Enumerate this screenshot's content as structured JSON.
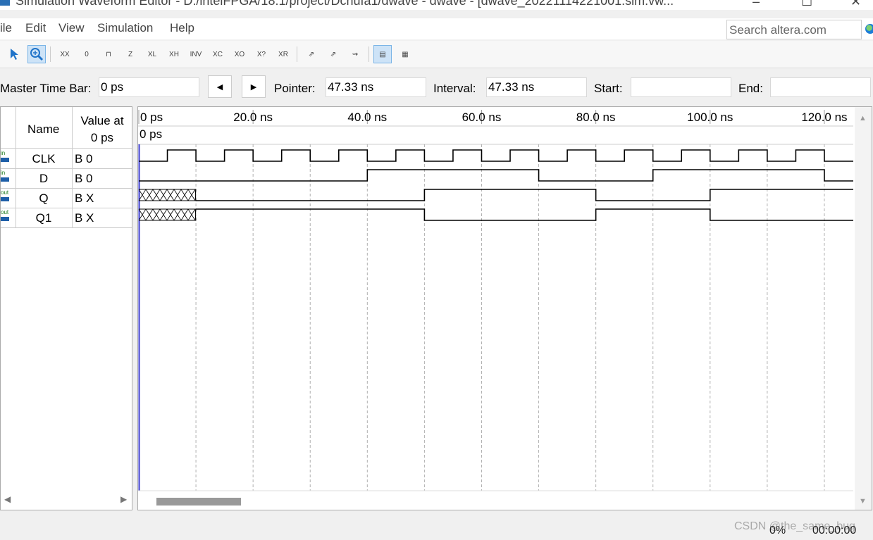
{
  "window": {
    "title": "Simulation Waveform Editor - D:/intelFPGA/18.1/project/Dchufa1/dwave - dwave - [dwave_20221114221001.sim.vw..."
  },
  "menu": [
    "ile",
    "Edit",
    "View",
    "Simulation",
    "Help"
  ],
  "search": {
    "placeholder": "Search altera.com"
  },
  "toolbar": {
    "items": [
      {
        "icon": "selection-tool-icon",
        "label": "select"
      },
      {
        "icon": "zoom-tool-icon",
        "label": "zoom"
      },
      {
        "icon": "force-unknown-icon",
        "label": "XX"
      },
      {
        "icon": "force-low-icon",
        "label": "0"
      },
      {
        "icon": "force-high-icon",
        "label": "1"
      },
      {
        "icon": "force-high-impedance-icon",
        "label": "Z"
      },
      {
        "icon": "force-weak-low-icon",
        "label": "L"
      },
      {
        "icon": "force-weak-high-icon",
        "label": "H"
      },
      {
        "icon": "invert-icon",
        "label": "INV"
      },
      {
        "icon": "count-value-icon",
        "label": "C"
      },
      {
        "icon": "overwrite-clock-icon",
        "label": "O"
      },
      {
        "icon": "arbitrary-value-icon",
        "label": "?"
      },
      {
        "icon": "random-value-icon",
        "label": "R"
      },
      {
        "icon": "run-functional-simulation-icon",
        "label": ""
      },
      {
        "icon": "run-timing-simulation-icon",
        "label": ""
      },
      {
        "icon": "generate-netlist-icon",
        "label": ""
      },
      {
        "icon": "snap-to-grid-icon",
        "label": ""
      },
      {
        "icon": "grid-settings-icon",
        "label": ""
      }
    ]
  },
  "timebar": {
    "master_label": "Master Time Bar:",
    "master_value": "0 ps",
    "pointer_label": "Pointer:",
    "pointer_value": "47.33 ns",
    "interval_label": "Interval:",
    "interval_value": "47.33 ns",
    "start_label": "Start:",
    "start_value": "",
    "end_label": "End:",
    "end_value": ""
  },
  "table": {
    "name_header": "Name",
    "value_header_line1": "Value at",
    "value_header_line2": "0 ps",
    "signals": [
      {
        "direction": "in",
        "name": "CLK",
        "value": "B 0"
      },
      {
        "direction": "in",
        "name": "D",
        "value": "B 0"
      },
      {
        "direction": "out",
        "name": "Q",
        "value": "B X"
      },
      {
        "direction": "out",
        "name": "Q1",
        "value": "B X"
      }
    ]
  },
  "waveform": {
    "time_unit": "ns",
    "ruler_labels": [
      "0 ps",
      "20.0 ns",
      "40.0 ns",
      "60.0 ns",
      "80.0 ns",
      "100.0 ns",
      "120.0 ns"
    ],
    "ruler_values_ns": [
      0,
      20,
      40,
      60,
      80,
      100,
      120
    ],
    "cursor_label": "0 ps",
    "view_end_ns": 125,
    "grid_step_ns": 10,
    "traces": {
      "CLK": {
        "init": 0,
        "transitions_ns": [
          5,
          10,
          15,
          20,
          25,
          30,
          35,
          40,
          45,
          50,
          55,
          60,
          65,
          70,
          75,
          80,
          85,
          90,
          95,
          100,
          105,
          110,
          115,
          120
        ]
      },
      "D": {
        "init": 0,
        "transitions_ns": [
          40,
          70,
          90,
          120
        ]
      },
      "Q": {
        "unknown_until_ns": 10,
        "init": 0,
        "transitions_ns": [
          50,
          80,
          100
        ]
      },
      "Q1": {
        "unknown_until_ns": 10,
        "init": 1,
        "transitions_ns": [
          50,
          80,
          100
        ]
      }
    }
  },
  "status": {
    "progress": "0%",
    "elapsed": "00:00:00",
    "watermark": "CSDN @the_same_bug"
  },
  "colors": {
    "accent": "#1f5fa8",
    "cursor": "#3a3acc",
    "grid": "#b0b0b0"
  }
}
